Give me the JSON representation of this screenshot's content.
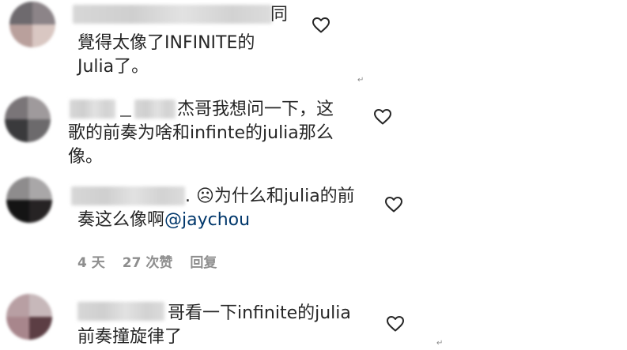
{
  "comments": [
    {
      "line1_suffix": "同",
      "line2": "覺得太像了INFINITE的",
      "line3": "Julia了。",
      "like_icon": "heart-outline-icon"
    },
    {
      "separator": "_",
      "line1_suffix": "杰哥我想问一下，这",
      "line2": "歌的前奏为啥和infinte的julia那么",
      "line3": "像。",
      "like_icon": "heart-outline-icon"
    },
    {
      "line1_suffix": ". ☹为什么和julia的前",
      "line2": "奏这么像啊",
      "mention": "@jaychou",
      "like_icon": "heart-outline-icon",
      "time": "4 天",
      "likes": "27 次赞",
      "reply": "回复"
    },
    {
      "line1_suffix": "哥看一下infinite的julia",
      "line2": "前奏撞旋律了",
      "like_icon": "heart-outline-icon"
    }
  ],
  "return_mark": "↵",
  "colors": {
    "text": "#262626",
    "meta": "#8e8e8e",
    "mention": "#00376b",
    "background": "#ffffff"
  }
}
